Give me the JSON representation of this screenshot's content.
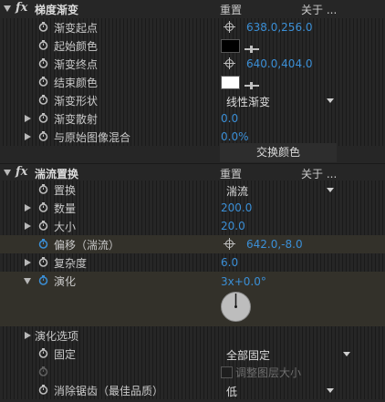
{
  "effects": [
    {
      "name": "梯度渐变",
      "reset": "重置",
      "about": "关于 ...",
      "params": {
        "start_point": {
          "label": "渐变起点",
          "value": "638.0,256.0"
        },
        "start_color": {
          "label": "起始颜色",
          "color": "#000000"
        },
        "end_point": {
          "label": "渐变终点",
          "value": "640.0,404.0"
        },
        "end_color": {
          "label": "结束颜色",
          "color": "#ffffff"
        },
        "shape": {
          "label": "渐变形状",
          "value": "线性渐变"
        },
        "scatter": {
          "label": "渐变散射",
          "value": "0.0"
        },
        "blend": {
          "label": "与原始图像混合",
          "value": "0.0%"
        },
        "swap_button": "交换颜色"
      }
    },
    {
      "name": "湍流置换",
      "reset": "重置",
      "about": "关于 ...",
      "params": {
        "displacement": {
          "label": "置换",
          "value": "湍流"
        },
        "amount": {
          "label": "数量",
          "value": "200.0"
        },
        "size": {
          "label": "大小",
          "value": "20.0"
        },
        "offset": {
          "label": "偏移（湍流）",
          "value": "642.0,-8.0"
        },
        "complexity": {
          "label": "复杂度",
          "value": "6.0"
        },
        "evolution": {
          "label": "演化",
          "value": "3x+0.0°"
        },
        "evolution_options": {
          "label": "演化选项"
        },
        "pinning": {
          "label": "固定",
          "value": "全部固定"
        },
        "resize_layer": {
          "label": "调整图层大小",
          "checked": false
        },
        "antialiasing": {
          "label": "消除锯齿（最佳品质）",
          "value": "低"
        }
      }
    }
  ]
}
